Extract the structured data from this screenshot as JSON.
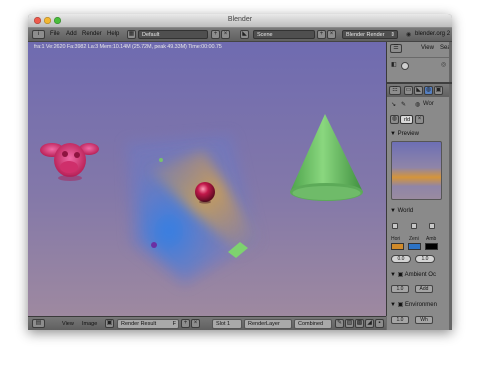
{
  "window": {
    "title": "Blender"
  },
  "header": {
    "menus": [
      "File",
      "Add",
      "Render",
      "Help"
    ],
    "layout": "Default",
    "scene": "Scene",
    "engine": "Blender Render",
    "link": "blender.org 2"
  },
  "viewport": {
    "stats": "fra:1 Ve:2620 Fa:3982 La:3 Mem:10.14M (25.72M, peak 49.33M) Time:00:00.75"
  },
  "footer": {
    "view": "View",
    "image": "Image",
    "image_name": "Render Result",
    "image_suffix": "F",
    "slot": "Slot 1",
    "layer": "RenderLayer",
    "pass": "Combined"
  },
  "outliner": {
    "view": "View",
    "search": "Sea"
  },
  "properties": {
    "world_tab": "Wor",
    "data_field": "rld",
    "preview": "Preview",
    "world": "World",
    "color_labels": [
      "Hori",
      "Zeni",
      "Amb"
    ],
    "colors": {
      "horizon": "#d08a2a",
      "zenith": "#2c73c6",
      "ambient": "#000000"
    },
    "exposure": "0.0",
    "range": "1.0",
    "ambient_occlusion": "Ambient Oc",
    "ao_factor": "1.0",
    "ao_mode": "Add",
    "environment": "Environmen",
    "env_energy": "1.0",
    "env_color": "Wh"
  },
  "icons": [
    "close-icon",
    "minimize-icon",
    "maximize-icon",
    "editor-type-icon",
    "screen-layout-icon",
    "scene-icon",
    "add-icon",
    "remove-icon",
    "chevron-down-icon",
    "blender-logo-icon",
    "image-icon",
    "world-icon",
    "render-icon",
    "expand-triangle-icon"
  ]
}
